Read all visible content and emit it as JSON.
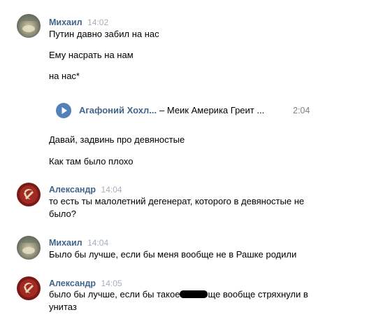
{
  "messages": [
    {
      "author": "Михаил",
      "time": "14:02",
      "lines": [
        "Путин давно забил на нас",
        "Ему насрать на нам",
        "на нас*"
      ]
    },
    {
      "audio": {
        "artist": "Агафоний Хохл...",
        "title": "– Меик Америка Греит ...",
        "duration": "2:04"
      },
      "lines": [
        "Давай, задвинь про девяностые",
        "Как там было плохо"
      ]
    },
    {
      "author": "Александр",
      "time": "14:04",
      "lines": [
        "то есть ты малолетний дегенерат, которого в девяностые не",
        "было?"
      ]
    },
    {
      "author": "Михаил",
      "time": "14:04",
      "lines": [
        "Было бы лучше, если бы меня вообще не в Рашке родили"
      ]
    },
    {
      "author": "Александр",
      "time": "14:05",
      "text_before_redaction": "было бы лучше, если бы такое",
      "text_after_redaction": "ще вообще стряхнули в",
      "line2": "унитаз"
    }
  ],
  "colors": {
    "author": "#42648b",
    "time": "#a5b0bc",
    "play_button": "#5181b8"
  },
  "icons": {
    "avatar_mikhail": "avatar-photo",
    "avatar_alexandr": "hammer-sickle-avatar",
    "play": "play-icon"
  }
}
